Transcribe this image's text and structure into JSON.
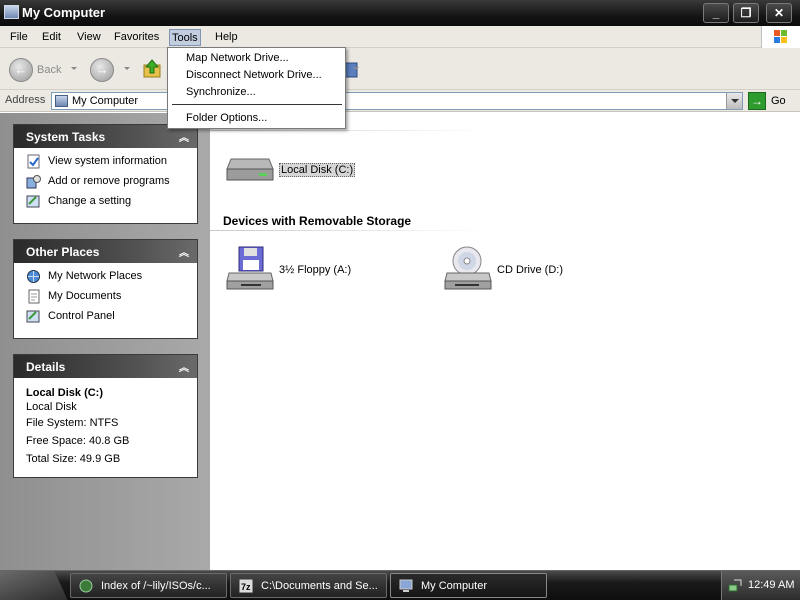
{
  "window": {
    "title": "My Computer",
    "controls": [
      "minimize",
      "maximize",
      "close"
    ]
  },
  "menubar": {
    "items": [
      "File",
      "Edit",
      "View",
      "Favorites",
      "Tools",
      "Help"
    ],
    "active": "Tools"
  },
  "tools_menu": {
    "items": [
      "Map Network Drive...",
      "Disconnect Network Drive...",
      "Synchronize...",
      "Folder Options..."
    ]
  },
  "toolbar": {
    "back_label": "Back"
  },
  "address": {
    "label": "Address",
    "value": "My Computer",
    "go_label": "Go"
  },
  "panels": {
    "system_tasks": {
      "title": "System Tasks",
      "items": [
        "View system information",
        "Add or remove programs",
        "Change a setting"
      ]
    },
    "other_places": {
      "title": "Other Places",
      "items": [
        "My Network Places",
        "My Documents",
        "Control Panel"
      ]
    },
    "details": {
      "title": "Details",
      "name": "Local Disk (C:)",
      "type": "Local Disk",
      "file_system": "File System: NTFS",
      "free_space": "Free Space: 40.8 GB",
      "total_size": "Total Size: 49.9 GB"
    }
  },
  "main": {
    "hard_drives": [
      {
        "label": "Local Disk (C:)",
        "selected": true,
        "icon": "hard-disk-icon"
      }
    ],
    "removable_group_title": "Devices with Removable Storage",
    "removable": [
      {
        "label": "3½ Floppy (A:)",
        "icon": "floppy-drive-icon"
      },
      {
        "label": "CD Drive (D:)",
        "icon": "cd-drive-icon"
      }
    ]
  },
  "taskbar": {
    "buttons": [
      {
        "label": "Index of /~lily/ISOs/c...",
        "active": false
      },
      {
        "label": "C:\\Documents and Se...",
        "active": false
      },
      {
        "label": "My Computer",
        "active": true
      }
    ],
    "clock": "12:49 AM"
  },
  "colors": {
    "title_bar": "#1a1a1a",
    "chrome": "#ece9e2",
    "side_pane": "#9a9a9a",
    "go_button": "#2e9b2e",
    "selection": "#d6d6d6"
  }
}
